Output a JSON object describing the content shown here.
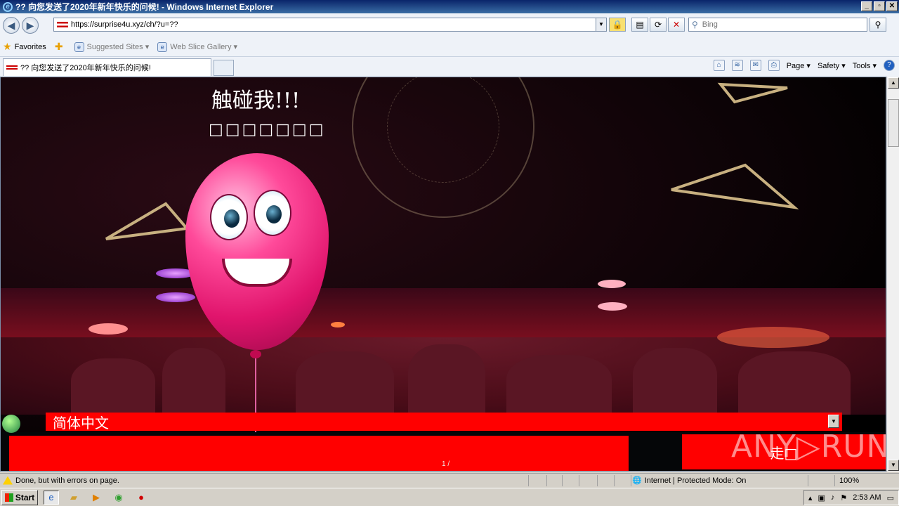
{
  "window": {
    "title": "?? 向您发送了2020年新年快乐的问候! - Windows Internet Explorer",
    "buttons": [
      "_",
      "▫",
      "✕"
    ]
  },
  "address_bar": {
    "url": "https://surprise4u.xyz/ch/?u=??",
    "search_placeholder": "Bing"
  },
  "favorites_bar": {
    "favorites_label": "Favorites",
    "items": [
      "Suggested Sites ▾",
      "Web Slice Gallery ▾"
    ]
  },
  "tab": {
    "title": "?? 向您发送了2020年新年快乐的问候!"
  },
  "command_bar": {
    "page": "Page ▾",
    "safety": "Safety ▾",
    "tools": "Tools ▾"
  },
  "page": {
    "headline": "触碰我!!!",
    "subline": "□□□□□□□",
    "language_select": "简体中文",
    "go_button": "走□",
    "page_indicator": "1 /",
    "watermark": "ANY▷RUN"
  },
  "status_bar": {
    "message": "Done, but with errors on page.",
    "zone": "Internet | Protected Mode: On",
    "zoom": "100%"
  },
  "taskbar": {
    "start": "Start",
    "time": "2:53 AM"
  }
}
